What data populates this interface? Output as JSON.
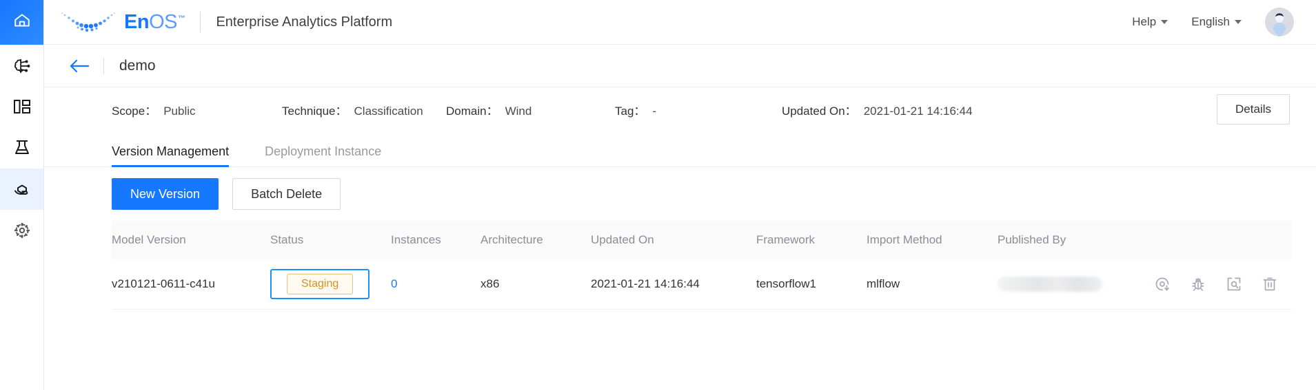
{
  "sidebar": {
    "items": [
      {
        "name": "home",
        "icon": "home-icon",
        "active": false
      },
      {
        "name": "ai-model",
        "icon": "brain-icon",
        "active": false
      },
      {
        "name": "dashboard",
        "icon": "layout-icon",
        "active": false
      },
      {
        "name": "lab",
        "icon": "flask-icon",
        "active": false
      },
      {
        "name": "model-serving",
        "icon": "hand-model-icon",
        "active": true
      },
      {
        "name": "settings",
        "icon": "settings-target-icon",
        "active": false
      }
    ]
  },
  "header": {
    "brand_en": "En",
    "brand_os": "OS",
    "brand_tm": "™",
    "subtitle": "Enterprise Analytics Platform",
    "help_label": "Help",
    "language_label": "English"
  },
  "breadcrumb": {
    "title": "demo"
  },
  "meta": {
    "scope_label": "Scope：",
    "scope_value": "Public",
    "technique_label": "Technique：",
    "technique_value": "Classification",
    "domain_label": "Domain：",
    "domain_value": "Wind",
    "tag_label": "Tag：",
    "tag_value": "-",
    "updated_label": "Updated On：",
    "updated_value": "2021-01-21 14:16:44",
    "details_button": "Details"
  },
  "tabs": [
    {
      "label": "Version Management",
      "active": true
    },
    {
      "label": "Deployment Instance",
      "active": false
    }
  ],
  "toolbar": {
    "new_version_label": "New Version",
    "batch_delete_label": "Batch Delete"
  },
  "table": {
    "columns": [
      "Model Version",
      "Status",
      "Instances",
      "Architecture",
      "Updated On",
      "Framework",
      "Import Method",
      "Published By",
      ""
    ],
    "rows": [
      {
        "model_version": "v210121-0611-c41u",
        "status": "Staging",
        "instances": "0",
        "architecture": "x86",
        "updated_on": "2021-01-21 14:16:44",
        "framework": "tensorflow1",
        "import_method": "mlflow",
        "published_by": "",
        "actions": [
          "deploy-icon",
          "debug-icon",
          "inspect-icon",
          "delete-icon"
        ]
      }
    ]
  },
  "colors": {
    "primary": "#1677ff",
    "badge_text": "#d98f1f",
    "badge_border": "#e8c07d",
    "badge_bg": "#fffaf0",
    "focus_ring": "#1890ff"
  }
}
